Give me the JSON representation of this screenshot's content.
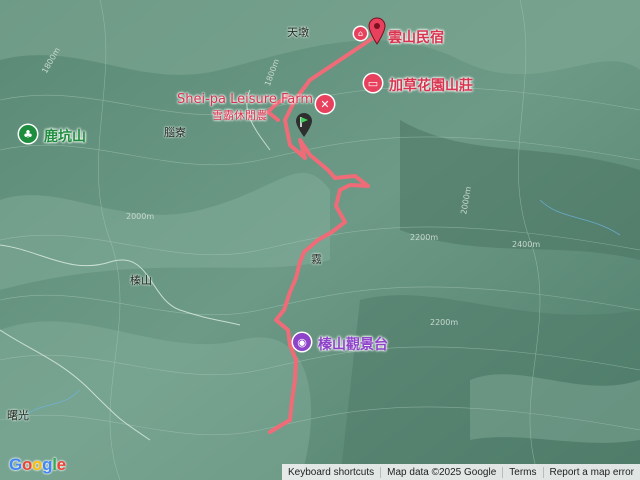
{
  "places": {
    "tiandun": "天墩",
    "xiekeng": "腦寮",
    "zhenshan": "榛山",
    "wu": "霧",
    "shuguang": "曙光"
  },
  "pois": {
    "yunshan": {
      "label": "雲山民宿",
      "color": "#e8415e"
    },
    "jiacao": {
      "label": "加草花園山莊",
      "color": "#e8415e"
    },
    "sheipa": {
      "label_en": "Shei-pa Leisure Farm",
      "label_zh": "雪霸休閒農",
      "color": "#e8415e"
    },
    "lukeng": {
      "label": "鹿坑山",
      "color": "#1e8e3e"
    },
    "zhenshan_view": {
      "label": "榛山觀景台",
      "color": "#8e44c9"
    }
  },
  "contours": [
    "1800m",
    "2000m",
    "2200m",
    "2400m",
    "2000m",
    "1800m",
    "2200m"
  ],
  "colors": {
    "track": "#f06b78",
    "terrain": "#5f8d7a"
  },
  "footer": {
    "shortcuts": "Keyboard shortcuts",
    "mapdata": "Map data ©2025 Google",
    "terms": "Terms",
    "report": "Report a map error"
  },
  "logo": {
    "text": "Google"
  }
}
